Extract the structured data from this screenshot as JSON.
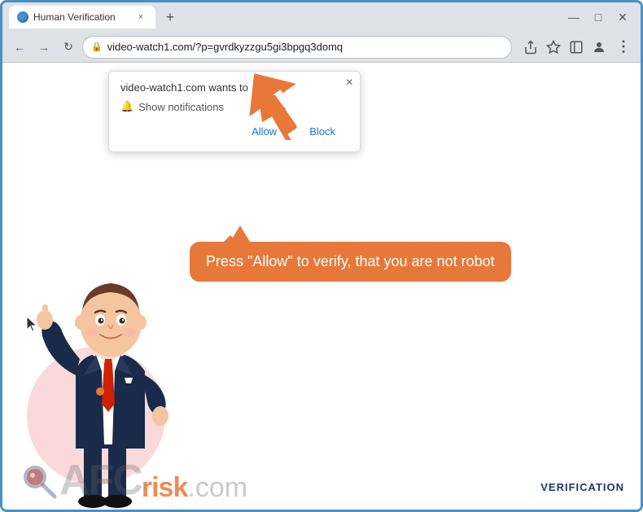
{
  "browser": {
    "tab": {
      "favicon_label": "favicon",
      "title": "Human Verification",
      "close_label": "×",
      "new_tab_label": "+"
    },
    "title_bar_controls": {
      "minimize": "—",
      "maximize": "□",
      "close": "✕"
    },
    "nav": {
      "back": "←",
      "forward": "→",
      "reload": "↻"
    },
    "address": {
      "lock_icon": "🔒",
      "url": "video-watch1.com/?p=gvrdkyzzgu5gi3bpgq3domq"
    },
    "address_actions": {
      "share": "⎋",
      "bookmark": "☆",
      "sidebar": "▭",
      "account": "👤",
      "more": "⋮"
    }
  },
  "notification_popup": {
    "title": "video-watch1.com wants to",
    "close": "×",
    "bell_icon": "🔔",
    "notification_label": "Show notifications",
    "allow_btn": "Allow",
    "block_btn": "Block"
  },
  "speech_bubble": {
    "text": "Press \"Allow\" to verify, that you are not robot"
  },
  "watermark": {
    "afc_text": "AFC",
    "risk_text": "risk",
    "com_text": ".com"
  },
  "verification_badge": {
    "text": "VERIFICATION"
  }
}
